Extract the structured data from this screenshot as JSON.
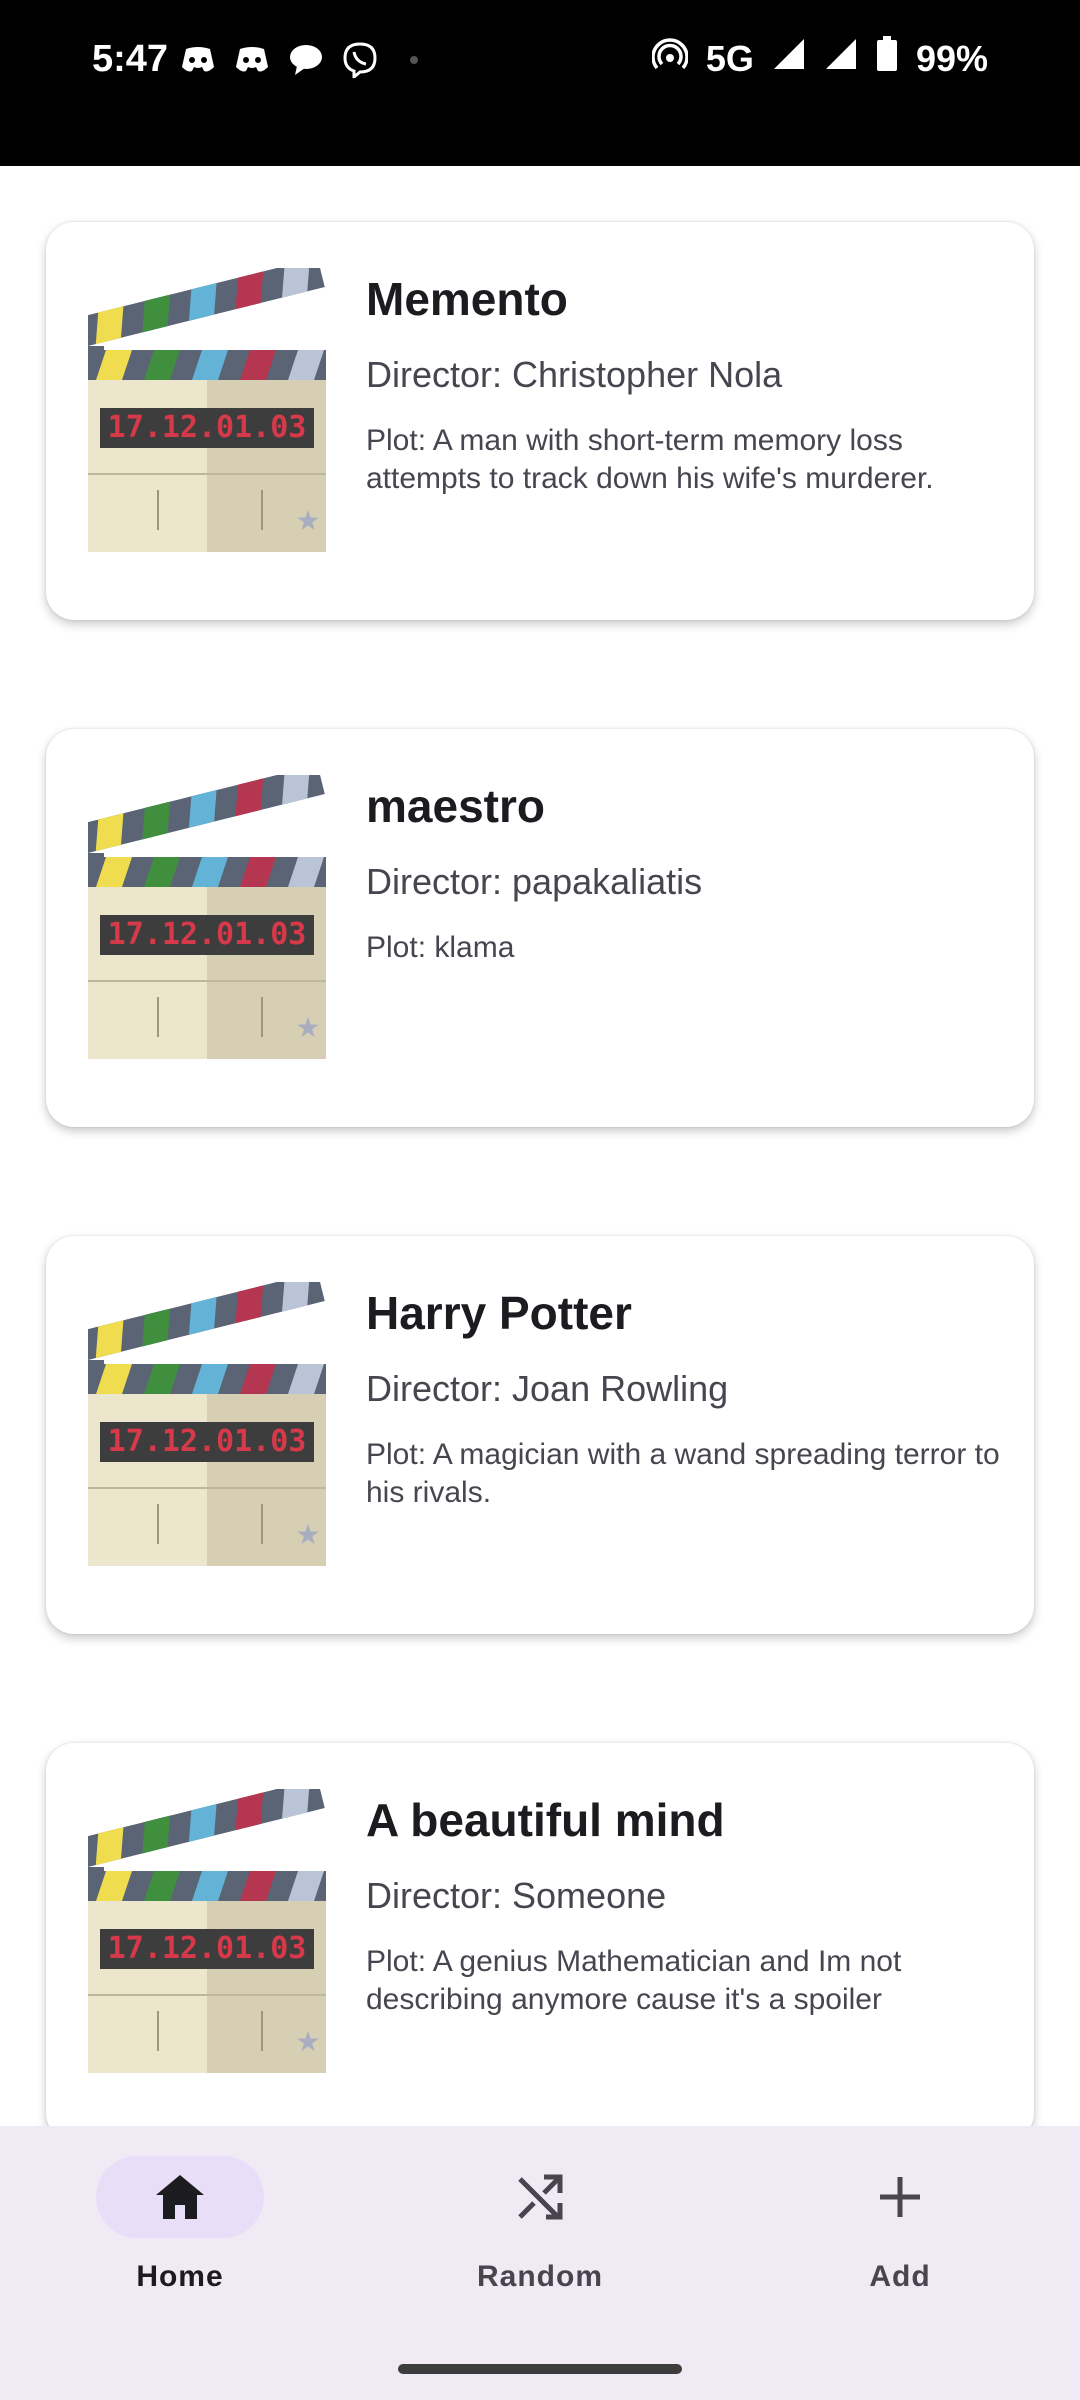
{
  "status_bar": {
    "time": "5:47",
    "network": "5G",
    "battery": "99%",
    "left_icons": [
      "discord-icon",
      "discord-icon",
      "chat-bubble-icon",
      "viber-icon"
    ]
  },
  "movies": [
    {
      "title": "Memento",
      "director": "Director: Christopher Nola",
      "plot": "Plot: A man with short-term memory loss attempts to track down his wife's murderer."
    },
    {
      "title": "maestro",
      "director": "Director: papakaliatis",
      "plot": "Plot: klama"
    },
    {
      "title": "Harry Potter",
      "director": "Director: Joan Rowling",
      "plot": "Plot: A magician with a wand spreading terror to his rivals."
    },
    {
      "title": "A beautiful mind",
      "director": "Director: Someone",
      "plot": "Plot: A genius Mathematician and Im not describing anymore cause it's a spoiler"
    }
  ],
  "thumbnail": {
    "slate_text": "17.12.01.03",
    "icon": "clapperboard-icon"
  },
  "nav": {
    "home": "Home",
    "random": "Random",
    "add": "Add"
  },
  "colors": {
    "nav_background": "#f0eaf5",
    "active_pill": "#e8def8",
    "slate_red": "#d63a4a"
  }
}
